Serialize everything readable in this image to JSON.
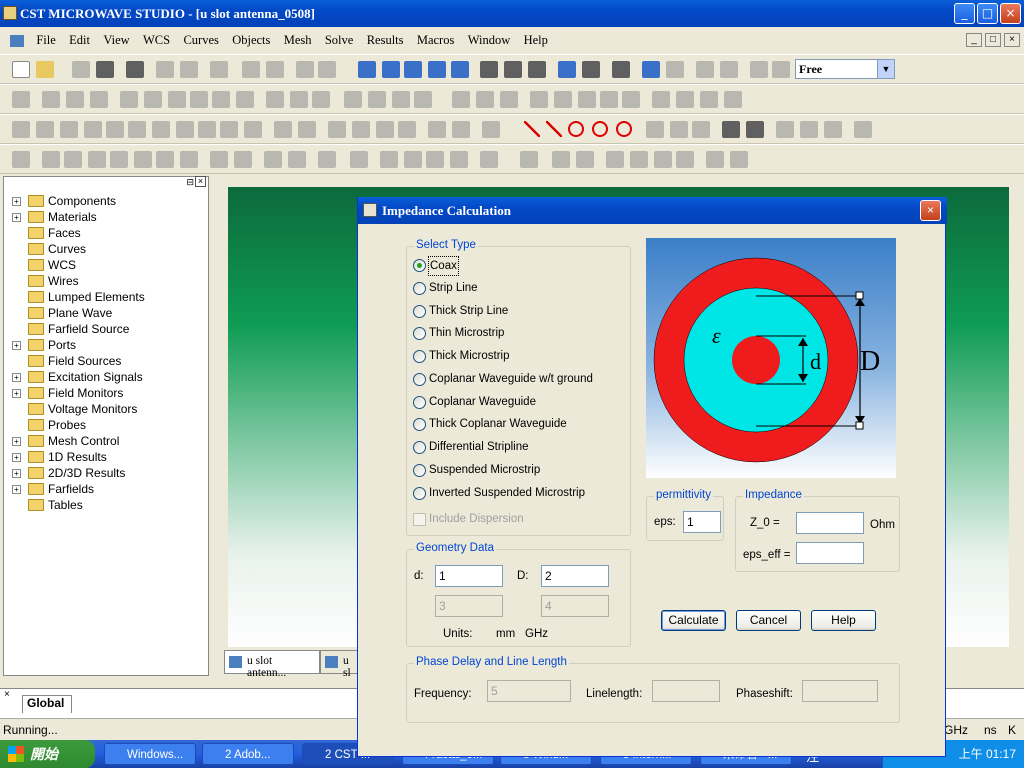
{
  "app": {
    "title": "CST MICROWAVE STUDIO - [u slot antenna_0508]",
    "window_buttons": [
      "_",
      "□",
      "×"
    ]
  },
  "menu": [
    "File",
    "Edit",
    "View",
    "WCS",
    "Curves",
    "Objects",
    "Mesh",
    "Solve",
    "Results",
    "Macros",
    "Window",
    "Help"
  ],
  "toolbar": {
    "mode_value": "Free"
  },
  "tree": {
    "items": [
      {
        "label": "Components",
        "expandable": true
      },
      {
        "label": "Materials",
        "expandable": true
      },
      {
        "label": "Faces",
        "expandable": false
      },
      {
        "label": "Curves",
        "expandable": false
      },
      {
        "label": "WCS",
        "expandable": false
      },
      {
        "label": "Wires",
        "expandable": false
      },
      {
        "label": "Lumped Elements",
        "expandable": false
      },
      {
        "label": "Plane Wave",
        "expandable": false
      },
      {
        "label": "Farfield Source",
        "expandable": false
      },
      {
        "label": "Ports",
        "expandable": true
      },
      {
        "label": "Field Sources",
        "expandable": false
      },
      {
        "label": "Excitation Signals",
        "expandable": true
      },
      {
        "label": "Field Monitors",
        "expandable": true
      },
      {
        "label": "Voltage Monitors",
        "expandable": false
      },
      {
        "label": "Probes",
        "expandable": false
      },
      {
        "label": "Mesh Control",
        "expandable": true
      },
      {
        "label": "1D Results",
        "expandable": true
      },
      {
        "label": "2D/3D Results",
        "expandable": true
      },
      {
        "label": "Farfields",
        "expandable": true
      },
      {
        "label": "Tables",
        "expandable": false
      }
    ]
  },
  "doc_tabs": [
    "u slot antenn...",
    "u sl"
  ],
  "global_tab": "Global",
  "status": {
    "text": "Running...",
    "units": [
      "GHz",
      "ns",
      "K"
    ]
  },
  "taskbar": {
    "start": "開始",
    "tasks": [
      "Windows...",
      "2 Adob...",
      "2 CST ...",
      "Fractal_0...",
      "8 Wind...",
      "5 Intern...",
      "未命名 - ..."
    ],
    "clock": "上午 01:17",
    "ime": "注"
  },
  "dialog": {
    "title": "Impedance Calculation",
    "select_type_label": "Select Type",
    "types": [
      "Coax",
      "Strip Line",
      "Thick Strip Line",
      "Thin Microstrip",
      "Thick Microstrip",
      "Coplanar Waveguide w/t ground",
      "Coplanar Waveguide",
      "Thick Coplanar Waveguide",
      "Differential Stripline",
      "Suspended Microstrip",
      "Inverted Suspended Microstrip"
    ],
    "selected_type": "Coax",
    "include_dispersion": "Include Dispersion",
    "geometry_label": "Geometry Data",
    "d_label": "d:",
    "d_value": "1",
    "D_label": "D:",
    "D_value": "2",
    "extra1": "3",
    "extra2": "4",
    "units_label": "Units:",
    "unit_length": "mm",
    "unit_freq": "GHz",
    "permittivity_label": "permittivity",
    "eps_label": "eps:",
    "eps_value": "1",
    "impedance_label": "Impedance",
    "z0_label": "Z_0 =",
    "z0_value": "",
    "ohm": "Ohm",
    "eps_eff_label": "eps_eff =",
    "eps_eff_value": "",
    "calculate": "Calculate",
    "cancel": "Cancel",
    "help": "Help",
    "phase_label": "Phase Delay and Line Length",
    "frequency_label": "Frequency:",
    "frequency_value": "5",
    "linelength_label": "Linelength:",
    "linelength_value": "",
    "phaseshift_label": "Phaseshift:",
    "phaseshift_value": "",
    "diagram": {
      "epsilon_symbol": "ε",
      "d_symbol": "d",
      "D_symbol": "D",
      "outer_color": "#ee1c1c",
      "dielectric_color": "#00e5e5",
      "inner_color": "#ee1c1c"
    }
  }
}
